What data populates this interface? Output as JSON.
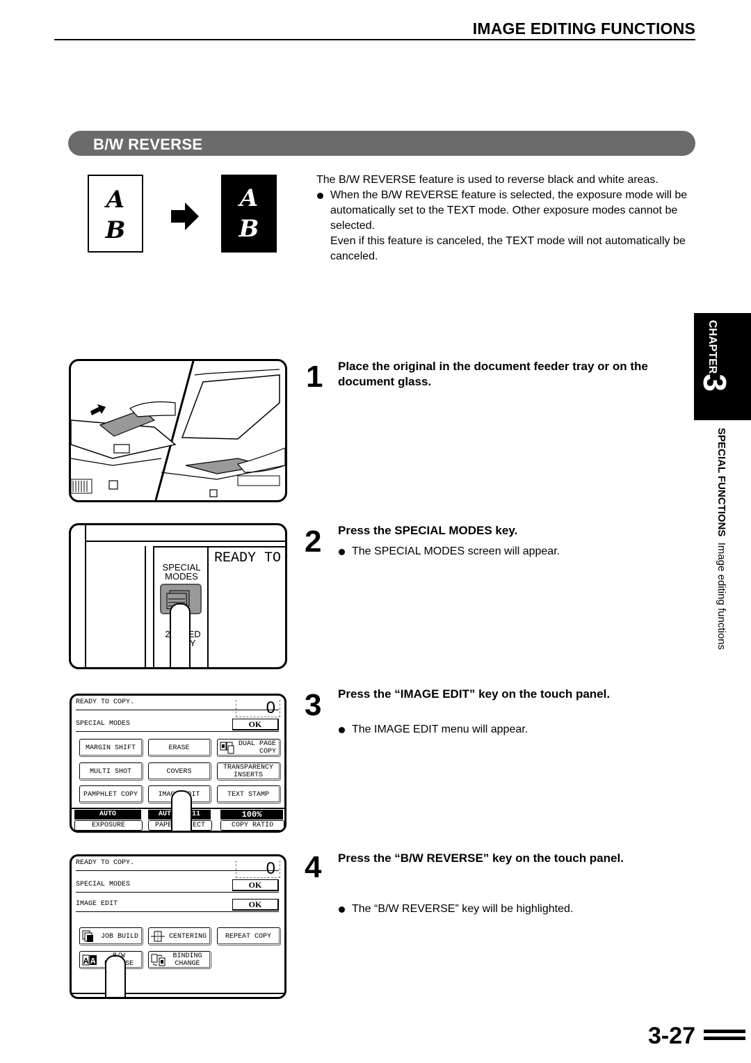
{
  "header": {
    "title": "IMAGE EDITING FUNCTIONS"
  },
  "section": {
    "title": "B/W REVERSE"
  },
  "illustration": {
    "original_letters": [
      "A",
      "B"
    ],
    "reversed_letters": [
      "A",
      "B"
    ],
    "arrow_icon": "right-arrow-icon"
  },
  "intro": {
    "lead": "The B/W REVERSE feature is used to reverse black and white areas.",
    "bullet": "When the B/W REVERSE feature is selected, the exposure mode will be automatically set to the TEXT mode. Other exposure modes cannot be selected.",
    "bullet_cont": "Even if this feature is canceled, the TEXT mode will not automatically be canceled."
  },
  "side_tab": {
    "chapter_word": "CHAPTER",
    "chapter_number": "3",
    "section_bold": "SPECIAL FUNCTIONS",
    "section_sub": "Image editing functions"
  },
  "steps": [
    {
      "number": "1",
      "title": "Place the original in the document feeder tray or on the document glass.",
      "note": ""
    },
    {
      "number": "2",
      "title": "Press the SPECIAL MODES key.",
      "note": "The SPECIAL MODES screen will appear."
    },
    {
      "number": "3",
      "title": "Press the “IMAGE EDIT” key on the touch panel.",
      "note": "The IMAGE EDIT menu will appear."
    },
    {
      "number": "4",
      "title": "Press the “B/W REVERSE” key on the touch panel.",
      "note": "The “B/W REVERSE” key will be highlighted."
    }
  ],
  "operation_panel": {
    "display_text": "READY TO C",
    "special_modes_label_1": "SPECIAL",
    "special_modes_label_2": "MODES",
    "duplex_label_1": "2-SIDED",
    "duplex_label_2": "COPY"
  },
  "touch_panel_1": {
    "status": "READY TO COPY.",
    "counter": "0",
    "menu_title": "SPECIAL MODES",
    "ok_label": "OK",
    "keys": [
      {
        "label": "MARGIN SHIFT"
      },
      {
        "label": "ERASE"
      },
      {
        "label": "DUAL PAGE COPY",
        "line1": "DUAL PAGE",
        "line2": "COPY"
      },
      {
        "label": "MULTI SHOT"
      },
      {
        "label": "COVERS"
      },
      {
        "label": "TRANSPARENCY INSERTS",
        "line1": "TRANSPARENCY",
        "line2": "INSERTS"
      },
      {
        "label": "PAMPHLET COPY"
      },
      {
        "label": "IMAGE EDIT"
      },
      {
        "label": "TEXT STAMP"
      }
    ],
    "status_bar": [
      {
        "value": "AUTO",
        "label": "EXPOSURE"
      },
      {
        "value": "AUTO 8½x11",
        "label": "PAPER SELECT"
      },
      {
        "value": "100%",
        "label": "COPY RATIO"
      }
    ]
  },
  "touch_panel_2": {
    "status": "READY TO COPY.",
    "counter": "0",
    "menu_title": "SPECIAL MODES",
    "submenu_title": "IMAGE EDIT",
    "ok_label": "OK",
    "keys": [
      {
        "label": "JOB BUILD",
        "icon": "job-build-icon"
      },
      {
        "label": "CENTERING",
        "icon": "centering-icon"
      },
      {
        "label": "REPEAT COPY"
      },
      {
        "label": "B/W REVERSE",
        "line1": "B/W",
        "line2": "REVERSE",
        "icon": "bw-reverse-icon"
      },
      {
        "label": "BINDING CHANGE",
        "line1": "BINDING",
        "line2": "CHANGE",
        "icon": "binding-change-icon"
      }
    ]
  },
  "page": {
    "number": "3-27"
  }
}
